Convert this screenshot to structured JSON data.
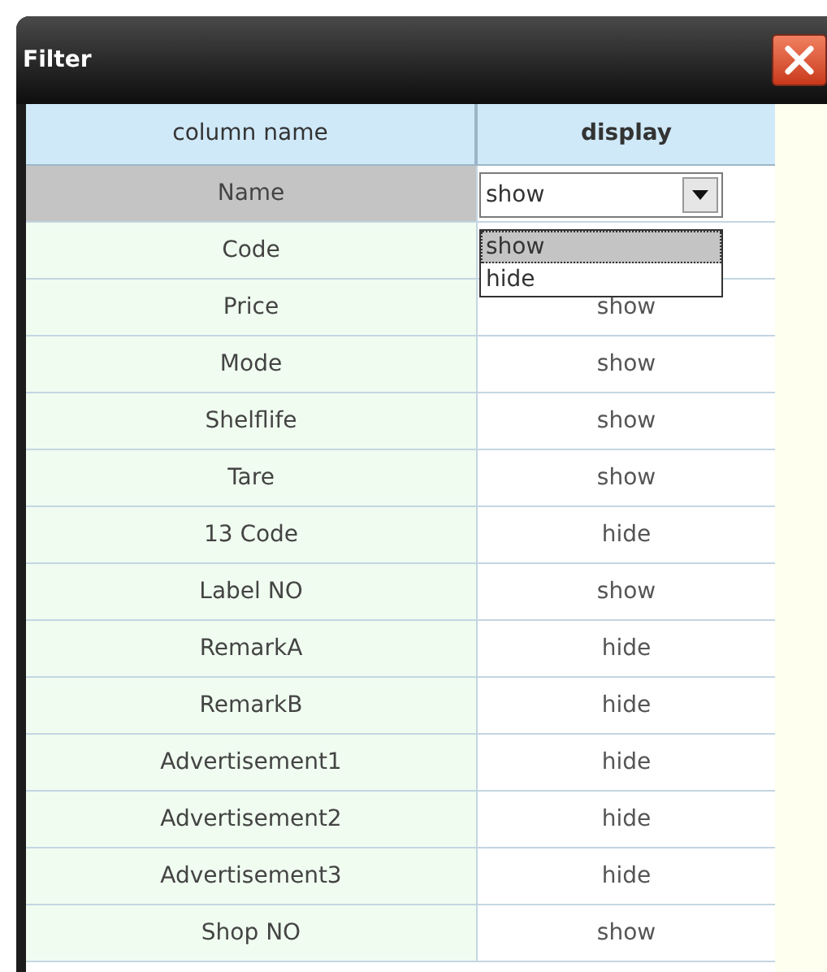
{
  "window": {
    "title": "Filter"
  },
  "table": {
    "columns": [
      {
        "label": "column name",
        "bold": false
      },
      {
        "label": "display",
        "bold": true
      }
    ],
    "rows": [
      {
        "name": "Name",
        "kind": "combo",
        "value": "show",
        "selected": true,
        "options": [
          {
            "label": "show",
            "selected": true
          },
          {
            "label": "hide",
            "selected": false
          }
        ]
      },
      {
        "name": "Code",
        "kind": "text",
        "selected": false
      },
      {
        "name": "Price",
        "kind": "text",
        "display": "show",
        "selected": false
      },
      {
        "name": "Mode",
        "kind": "text",
        "display": "show",
        "selected": false
      },
      {
        "name": "Shelflife",
        "kind": "text",
        "display": "show",
        "selected": false
      },
      {
        "name": "Tare",
        "kind": "text",
        "display": "show",
        "selected": false
      },
      {
        "name": "13 Code",
        "kind": "text",
        "display": "hide",
        "selected": false
      },
      {
        "name": "Label NO",
        "kind": "text",
        "display": "show",
        "selected": false
      },
      {
        "name": "RemarkA",
        "kind": "text",
        "display": "hide",
        "selected": false
      },
      {
        "name": "RemarkB",
        "kind": "text",
        "display": "hide",
        "selected": false
      },
      {
        "name": "Advertisement1",
        "kind": "text",
        "display": "hide",
        "selected": false
      },
      {
        "name": "Advertisement2",
        "kind": "text",
        "display": "hide",
        "selected": false
      },
      {
        "name": "Advertisement3",
        "kind": "text",
        "display": "hide",
        "selected": false
      },
      {
        "name": "Shop NO",
        "kind": "text",
        "display": "show",
        "selected": false
      }
    ]
  }
}
